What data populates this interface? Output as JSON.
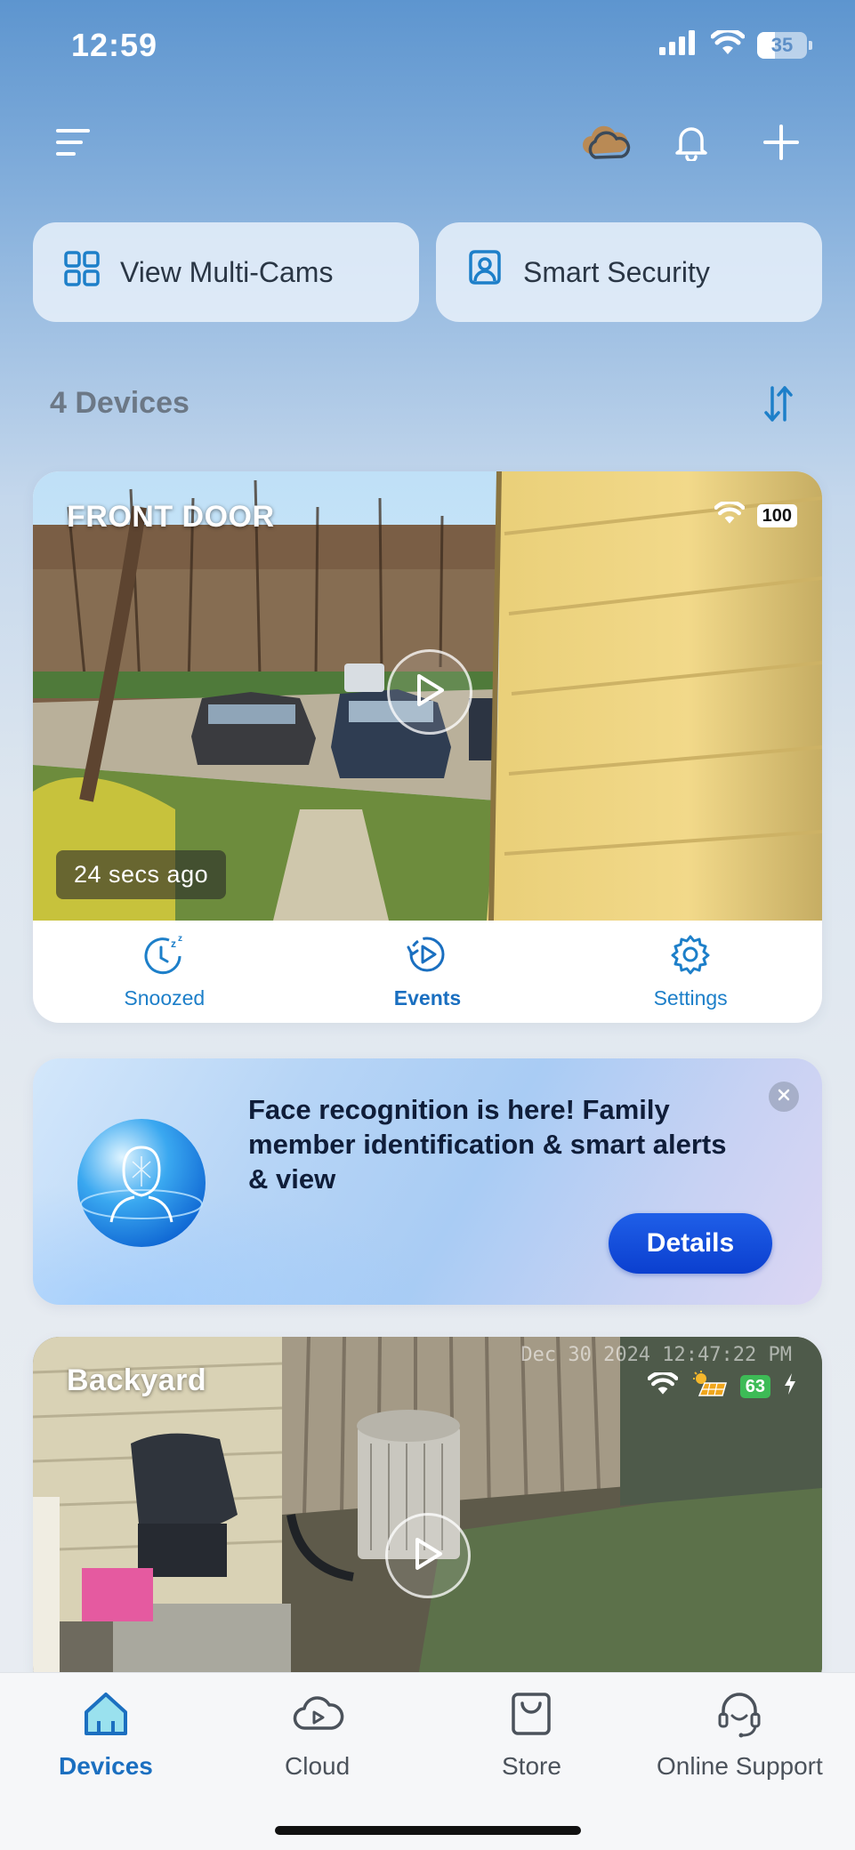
{
  "status_bar": {
    "time": "12:59",
    "battery": "35",
    "battery_level": 0.35
  },
  "quick_actions": [
    {
      "label": "View Multi-Cams",
      "icon": "grid-icon"
    },
    {
      "label": "Smart Security",
      "icon": "shield-person-icon"
    }
  ],
  "devices": {
    "count_label": "4 Devices"
  },
  "cameras": [
    {
      "name": "FRONT DOOR",
      "battery": "100",
      "last_seen": "24 secs ago",
      "actions": [
        {
          "label": "Snoozed",
          "icon": "snooze-icon"
        },
        {
          "label": "Events",
          "icon": "events-icon"
        },
        {
          "label": "Settings",
          "icon": "gear-icon"
        }
      ]
    },
    {
      "name": "Backyard",
      "battery": "63",
      "overlay_timestamp": "Dec 30 2024 12:47:22 PM"
    }
  ],
  "promo": {
    "text": "Face recognition is here! Family member identification & smart alerts & view",
    "button_label": "Details"
  },
  "bottom_nav": [
    {
      "label": "Devices",
      "icon": "home-icon",
      "active": true
    },
    {
      "label": "Cloud",
      "icon": "cloud-play-icon",
      "active": false
    },
    {
      "label": "Store",
      "icon": "bag-icon",
      "active": false
    },
    {
      "label": "Online Support",
      "icon": "headset-icon",
      "active": false
    }
  ],
  "colors": {
    "accent": "#1d7fc9",
    "cta": "#0b3fcf",
    "battery_green": "#3dbb56"
  }
}
